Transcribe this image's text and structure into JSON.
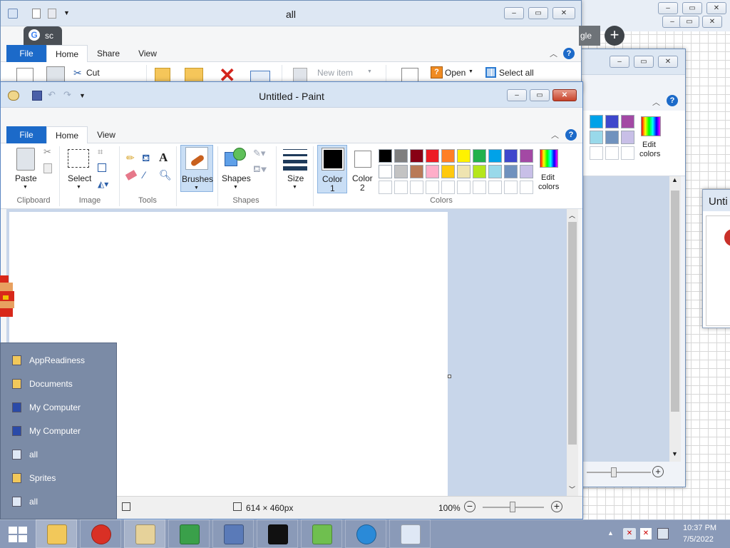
{
  "explorer": {
    "title": "all",
    "tabs": {
      "file": "File",
      "home": "Home",
      "share": "Share",
      "view": "View"
    },
    "cut": "Cut",
    "new_item": "New item",
    "open": "Open",
    "select_all": "Select all",
    "browser_fragment": "sc",
    "browser_fragment2": "gle"
  },
  "right_window": {
    "edit_colors_1": "Edit",
    "edit_colors_2": "colors"
  },
  "far_right_window": {
    "title_fragment": "Unti"
  },
  "paint": {
    "title": "Untitled - Paint",
    "tabs": {
      "file": "File",
      "home": "Home",
      "view": "View"
    },
    "tools": {
      "paste": "Paste",
      "select": "Select",
      "brushes": "Brushes",
      "shapes": "Shapes",
      "size": "Size",
      "color1_a": "Color",
      "color1_b": "1",
      "color2_a": "Color",
      "color2_b": "2",
      "edit_colors_a": "Edit",
      "edit_colors_b": "colors"
    },
    "groups": {
      "clipboard": "Clipboard",
      "image": "Image",
      "tools": "Tools",
      "shapes": "Shapes",
      "colors": "Colors"
    },
    "palette_row1": [
      "#000000",
      "#7f7f7f",
      "#880015",
      "#ed1c24",
      "#ff7f27",
      "#fff200",
      "#22b14c",
      "#00a2e8",
      "#3f48cc",
      "#a349a4"
    ],
    "palette_row2": [
      "#ffffff",
      "#c3c3c3",
      "#b97a57",
      "#ffaec9",
      "#ffc90e",
      "#efe4b0",
      "#b5e61d",
      "#99d9ea",
      "#7092be",
      "#c8bfe7"
    ],
    "status": {
      "dimensions": "614 × 460px",
      "zoom": "100%"
    }
  },
  "jumplist": {
    "items": [
      {
        "label": "AppReadiness",
        "icon": "folder-icon"
      },
      {
        "label": "Documents",
        "icon": "folder-icon"
      },
      {
        "label": "My Computer",
        "icon": "computer-icon"
      },
      {
        "label": "My Computer",
        "icon": "computer-icon"
      },
      {
        "label": "all",
        "icon": "document-icon"
      },
      {
        "label": "Sprites",
        "icon": "folder-icon"
      },
      {
        "label": "all",
        "icon": "document-icon"
      }
    ]
  },
  "taskbar": {
    "time": "10:37 PM",
    "date": "7/5/2022",
    "apps": [
      "start-icon",
      "file-explorer-icon",
      "chrome-icon",
      "paint-icon",
      "download-icon",
      "puzzle-icon",
      "cmd-icon",
      "notepad-plus-icon",
      "internet-explorer-icon",
      "window-icon"
    ]
  }
}
